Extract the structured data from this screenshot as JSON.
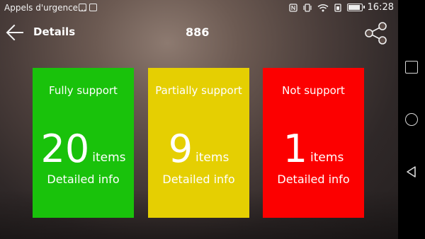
{
  "status_bar": {
    "notification_text": "Appels d'urgence…",
    "time": "16:28",
    "battery_level": 0.8,
    "icons": [
      "phone-screen-icon",
      "image-icon",
      "nfc-icon",
      "vibrate-icon",
      "wifi-icon",
      "data-icon",
      "battery-icon"
    ]
  },
  "toolbar": {
    "back_icon": "arrow-left-icon",
    "title": "Details",
    "center_text": "886",
    "share_icon": "share-icon"
  },
  "cards": [
    {
      "heading": "Fully support",
      "count": "20",
      "unit": "items",
      "link": "Detailed info",
      "color": "#19c20b"
    },
    {
      "heading": "Partially support",
      "count": "9",
      "unit": "items",
      "link": "Detailed info",
      "color": "#e5cf02"
    },
    {
      "heading": "Not support",
      "count": "1",
      "unit": "items",
      "link": "Detailed info",
      "color": "#fc0000"
    }
  ],
  "nav_bar": {
    "buttons": [
      "recent-apps-icon",
      "home-icon",
      "back-icon"
    ]
  }
}
